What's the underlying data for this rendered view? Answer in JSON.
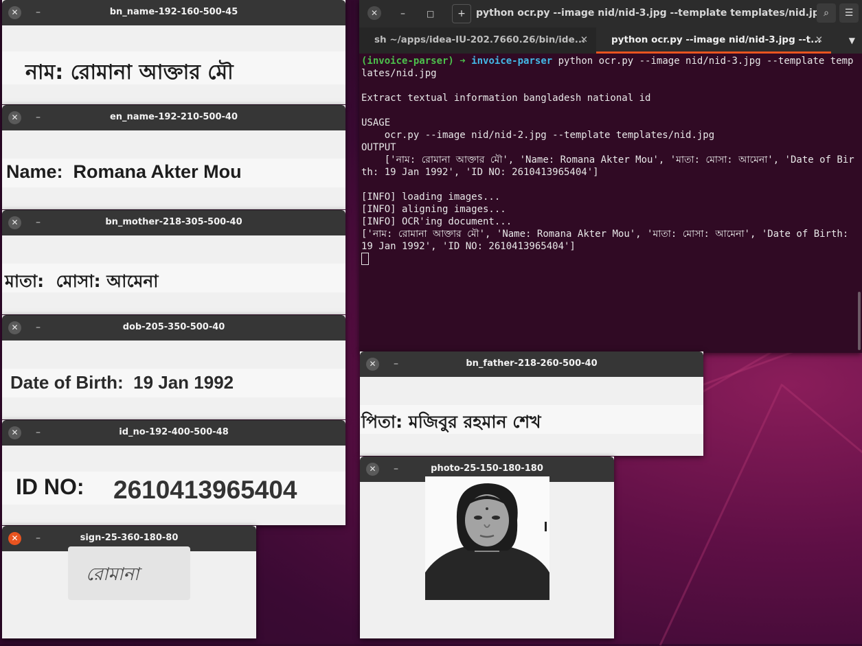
{
  "windows": {
    "bn_name": {
      "title": "bn_name-192-160-500-45",
      "text": "নাম: রোমানা আক্তার মৌ"
    },
    "en_name": {
      "title": "en_name-192-210-500-40",
      "text": "Name:  Romana Akter Mou"
    },
    "bn_mother": {
      "title": "bn_mother-218-305-500-40",
      "text": "মাতা:  মোসা: আমেনা"
    },
    "dob": {
      "title": "dob-205-350-500-40",
      "text": "Date of Birth:  19 Jan 1992"
    },
    "id_no": {
      "title": "id_no-192-400-500-48",
      "label": "ID NO:",
      "value": "2610413965404"
    },
    "sign": {
      "title": "sign-25-360-180-80",
      "text": "রোমানা"
    },
    "bn_father": {
      "title": "bn_father-218-260-500-40",
      "text": "পিতা: মজিবুর রহমান শেখ"
    },
    "photo": {
      "title": "photo-25-150-180-180"
    }
  },
  "icons": {
    "close": "✕",
    "minimize": "–"
  },
  "terminal": {
    "title": "python ocr.py --image nid/nid-3.jpg --template templates/nid.jpg",
    "tabs": [
      {
        "label": "sh ~/apps/idea-IU-202.7660.26/bin/ide...",
        "active": false
      },
      {
        "label": "python ocr.py --image nid/nid-3.jpg --t...",
        "active": true
      }
    ],
    "prompt_env": "(invoice-parser)",
    "prompt_arrow": "➜",
    "prompt_dir": "invoice-parser",
    "command": " python ocr.py --image nid/nid-3.jpg --template templates/nid.jpg",
    "lines": [
      "",
      "Extract textual information bangladesh national id",
      "",
      "USAGE",
      "    ocr.py --image nid/nid-2.jpg --template templates/nid.jpg",
      "OUTPUT",
      "    ['নাম: রোমানা আক্তার মৌ', 'Name: Romana Akter Mou', 'মাতা: মোসা: আমেনা', 'Date of Birth: 19 Jan 1992', 'ID NO: 2610413965404']",
      "",
      "[INFO] loading images...",
      "[INFO] aligning images...",
      "[INFO] OCR'ing document...",
      "['নাম: রোমানা আক্তার মৌ', 'Name: Romana Akter Mou', 'মাতা: মোসা: আমেনা', 'Date of Birth: 19 Jan 1992', 'ID NO: 2610413965404']"
    ]
  }
}
